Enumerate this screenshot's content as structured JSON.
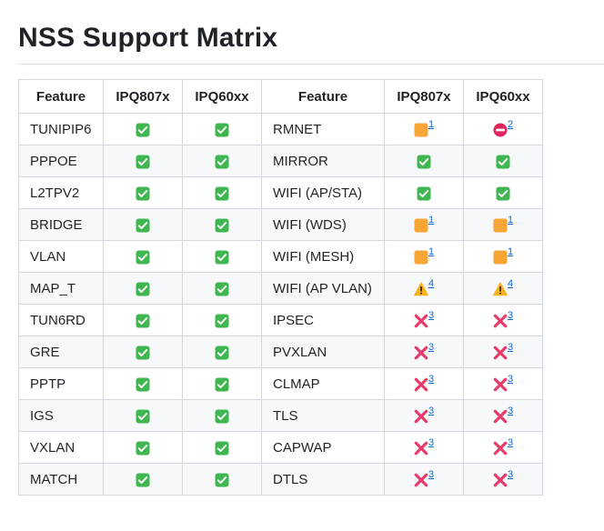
{
  "page": {
    "title": "NSS Support Matrix"
  },
  "icon_colors": {
    "check": "#3fb64f",
    "orange": "#f7a534",
    "noentry": "#e0245e",
    "warning": "#f7b21e",
    "cross": "#e63b6a"
  },
  "table": {
    "headers": [
      "Feature",
      "IPQ807x",
      "IPQ60xx",
      "Feature",
      "IPQ807x",
      "IPQ60xx"
    ],
    "rows": [
      {
        "feature1": "TUNIPIP6",
        "ipq807x_1": {
          "icon": "check"
        },
        "ipq60xx_1": {
          "icon": "check"
        },
        "feature2": "RMNET",
        "ipq807x_2": {
          "icon": "orange-square",
          "note": "1"
        },
        "ipq60xx_2": {
          "icon": "no-entry",
          "note": "2"
        }
      },
      {
        "feature1": "PPPOE",
        "ipq807x_1": {
          "icon": "check"
        },
        "ipq60xx_1": {
          "icon": "check"
        },
        "feature2": "MIRROR",
        "ipq807x_2": {
          "icon": "check"
        },
        "ipq60xx_2": {
          "icon": "check"
        }
      },
      {
        "feature1": "L2TPV2",
        "ipq807x_1": {
          "icon": "check"
        },
        "ipq60xx_1": {
          "icon": "check"
        },
        "feature2": "WIFI (AP/STA)",
        "ipq807x_2": {
          "icon": "check"
        },
        "ipq60xx_2": {
          "icon": "check"
        }
      },
      {
        "feature1": "BRIDGE",
        "ipq807x_1": {
          "icon": "check"
        },
        "ipq60xx_1": {
          "icon": "check"
        },
        "feature2": "WIFI (WDS)",
        "ipq807x_2": {
          "icon": "orange-square",
          "note": "1"
        },
        "ipq60xx_2": {
          "icon": "orange-square",
          "note": "1"
        }
      },
      {
        "feature1": "VLAN",
        "ipq807x_1": {
          "icon": "check"
        },
        "ipq60xx_1": {
          "icon": "check"
        },
        "feature2": "WIFI (MESH)",
        "ipq807x_2": {
          "icon": "orange-square",
          "note": "1"
        },
        "ipq60xx_2": {
          "icon": "orange-square",
          "note": "1"
        }
      },
      {
        "feature1": "MAP_T",
        "ipq807x_1": {
          "icon": "check"
        },
        "ipq60xx_1": {
          "icon": "check"
        },
        "feature2": "WIFI (AP VLAN)",
        "ipq807x_2": {
          "icon": "warning",
          "note": "4"
        },
        "ipq60xx_2": {
          "icon": "warning",
          "note": "4"
        }
      },
      {
        "feature1": "TUN6RD",
        "ipq807x_1": {
          "icon": "check"
        },
        "ipq60xx_1": {
          "icon": "check"
        },
        "feature2": "IPSEC",
        "ipq807x_2": {
          "icon": "cross",
          "note": "3"
        },
        "ipq60xx_2": {
          "icon": "cross",
          "note": "3"
        }
      },
      {
        "feature1": "GRE",
        "ipq807x_1": {
          "icon": "check"
        },
        "ipq60xx_1": {
          "icon": "check"
        },
        "feature2": "PVXLAN",
        "ipq807x_2": {
          "icon": "cross",
          "note": "3"
        },
        "ipq60xx_2": {
          "icon": "cross",
          "note": "3"
        }
      },
      {
        "feature1": "PPTP",
        "ipq807x_1": {
          "icon": "check"
        },
        "ipq60xx_1": {
          "icon": "check"
        },
        "feature2": "CLMAP",
        "ipq807x_2": {
          "icon": "cross",
          "note": "3"
        },
        "ipq60xx_2": {
          "icon": "cross",
          "note": "3"
        }
      },
      {
        "feature1": "IGS",
        "ipq807x_1": {
          "icon": "check"
        },
        "ipq60xx_1": {
          "icon": "check"
        },
        "feature2": "TLS",
        "ipq807x_2": {
          "icon": "cross",
          "note": "3"
        },
        "ipq60xx_2": {
          "icon": "cross",
          "note": "3"
        }
      },
      {
        "feature1": "VXLAN",
        "ipq807x_1": {
          "icon": "check"
        },
        "ipq60xx_1": {
          "icon": "check"
        },
        "feature2": "CAPWAP",
        "ipq807x_2": {
          "icon": "cross",
          "note": "3"
        },
        "ipq60xx_2": {
          "icon": "cross",
          "note": "3"
        }
      },
      {
        "feature1": "MATCH",
        "ipq807x_1": {
          "icon": "check"
        },
        "ipq60xx_1": {
          "icon": "check"
        },
        "feature2": "DTLS",
        "ipq807x_2": {
          "icon": "cross",
          "note": "3"
        },
        "ipq60xx_2": {
          "icon": "cross",
          "note": "3"
        }
      }
    ]
  }
}
